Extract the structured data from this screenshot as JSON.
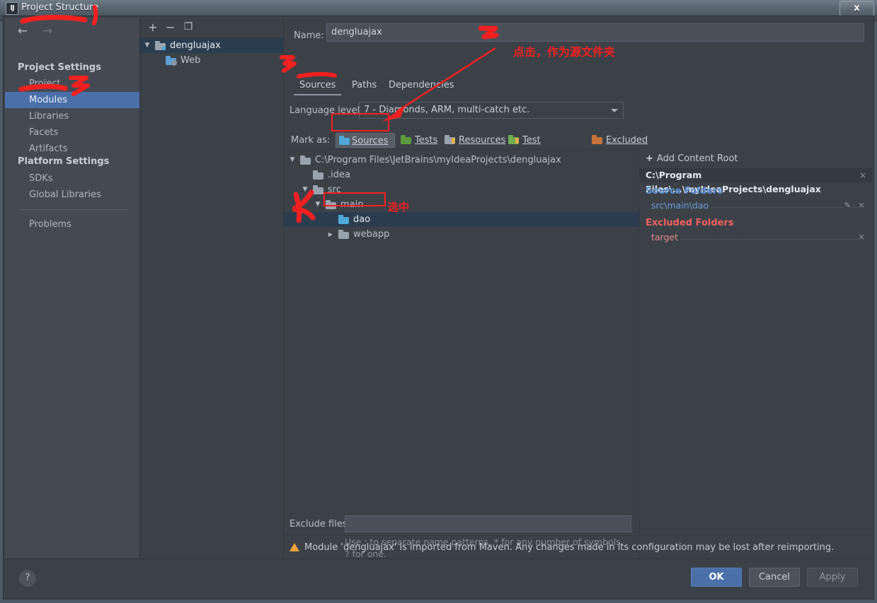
{
  "window": {
    "title": "Project Structure",
    "app_icon": "intellij-idea-icon",
    "close_label": "x"
  },
  "sidebar": {
    "nav": {
      "back": "←",
      "forward": "→"
    },
    "groups": [
      {
        "title": "Project Settings",
        "items": [
          {
            "label": "Project",
            "selected": false
          },
          {
            "label": "Modules",
            "selected": true
          },
          {
            "label": "Libraries",
            "selected": false
          },
          {
            "label": "Facets",
            "selected": false
          },
          {
            "label": "Artifacts",
            "selected": false
          }
        ]
      },
      {
        "title": "Platform Settings",
        "items": [
          {
            "label": "SDKs",
            "selected": false
          },
          {
            "label": "Global Libraries",
            "selected": false
          }
        ]
      }
    ],
    "footer_items": [
      {
        "label": "Problems",
        "selected": false
      }
    ]
  },
  "module_list": {
    "toolbar": [
      {
        "name": "add-module-button",
        "glyph": "+"
      },
      {
        "name": "remove-module-button",
        "glyph": "−"
      },
      {
        "name": "copy-module-button",
        "glyph": "❐"
      }
    ],
    "rows": [
      {
        "label": "dengluajax",
        "indent": 0,
        "expander": "▼",
        "icon": "module-folder-icon",
        "icon_color": "#9aa3ad",
        "selected": true
      },
      {
        "label": "Web",
        "indent": 1,
        "expander": "",
        "icon": "web-facet-icon",
        "icon_color": "#5a9fd4",
        "selected": false
      }
    ]
  },
  "main": {
    "name_label": "Name:",
    "name_value": "dengluajax",
    "tabs": [
      {
        "label": "Sources",
        "active": true
      },
      {
        "label": "Paths",
        "active": false
      },
      {
        "label": "Dependencies",
        "active": false
      }
    ],
    "language_level_label": "Language level:",
    "language_level_value": "7 - Diamonds, ARM, multi-catch etc.",
    "mark_as_label": "Mark as:",
    "mark_as_buttons": [
      {
        "label": "Sources",
        "mnemonic": "S",
        "color": "#4fa8d8",
        "pressed": true
      },
      {
        "label": "Tests",
        "mnemonic": "T",
        "color": "#5b9a3e",
        "pressed": false
      },
      {
        "label": "Resources",
        "mnemonic": "R",
        "color": "#9aa3ad",
        "pressed": false
      },
      {
        "label": "Test Resources",
        "mnemonic": "T",
        "color": "#6fae52",
        "pressed": false
      },
      {
        "label": "Excluded",
        "mnemonic": "E",
        "color": "#c4743a",
        "pressed": false
      }
    ],
    "tree": [
      {
        "label": "C:\\Program Files\\JetBrains\\myIdeaProjects\\dengluajax",
        "indent": 0,
        "expander": "▼",
        "color": "#9aa3ad",
        "selected": false
      },
      {
        "label": ".idea",
        "indent": 1,
        "expander": "",
        "color": "#9aa3ad",
        "selected": false
      },
      {
        "label": "src",
        "indent": 1,
        "expander": "▼",
        "color": "#9aa3ad",
        "selected": false
      },
      {
        "label": "main",
        "indent": 2,
        "expander": "▼",
        "color": "#9aa3ad",
        "selected": false
      },
      {
        "label": "dao",
        "indent": 3,
        "expander": "",
        "color": "#4fa8d8",
        "selected": true
      },
      {
        "label": "webapp",
        "indent": 3,
        "expander": "▶",
        "color": "#9aa3ad",
        "selected": false
      }
    ],
    "exclude_files_label": "Exclude files:",
    "exclude_files_value": "",
    "exclude_files_hint": "Use ; to separate name patterns, * for any number of symbols, ? for one.",
    "warning": "Module 'dengluajax' is imported from Maven. Any changes made in its configuration may be lost after reimporting."
  },
  "content_roots": {
    "add_label": "Add Content Root",
    "add_mnemonic": "C",
    "root_path": "C:\\Program Files\\...\\myIdeaProjects\\dengluajax",
    "remove_glyph": "×",
    "groups": [
      {
        "title": "Source Folders",
        "title_color": "#5b8fd4",
        "items": [
          {
            "label": "src\\main\\dao",
            "color": "#6d9ed8",
            "edit": "✎",
            "remove": "×"
          }
        ]
      },
      {
        "title": "Excluded Folders",
        "title_color": "#f06060",
        "items": [
          {
            "label": "target",
            "color": "#e08a8a",
            "edit": "",
            "remove": "×"
          }
        ]
      }
    ]
  },
  "buttons": {
    "help": "?",
    "ok": "OK",
    "cancel": "Cancel",
    "apply": "Apply"
  },
  "annotations": {
    "color": "#f22020",
    "marks": [
      {
        "name": "annotation-number-1",
        "text": "1"
      },
      {
        "name": "annotation-number-2",
        "text": "2"
      },
      {
        "name": "annotation-number-3",
        "text": "3"
      },
      {
        "name": "annotation-number-4",
        "text": "4"
      },
      {
        "name": "annotation-number-5",
        "text": "5"
      }
    ],
    "note_click_source": "点击，作为源文件夹",
    "note_selected": "选中"
  }
}
